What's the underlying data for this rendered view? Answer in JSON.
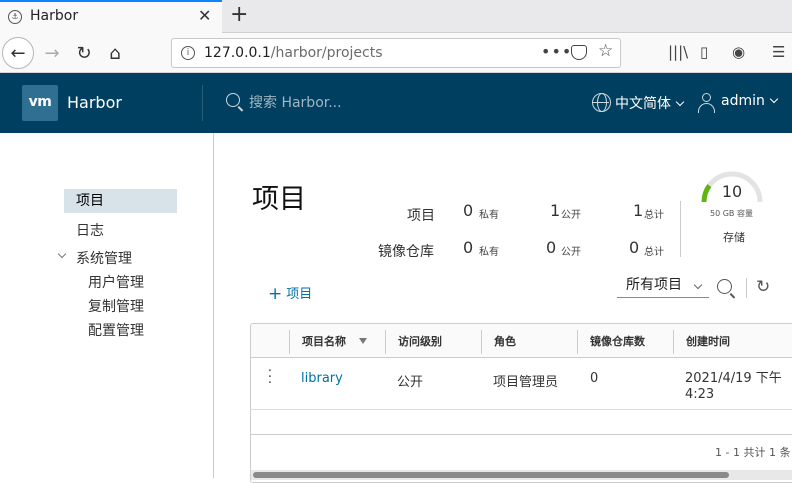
{
  "browser": {
    "tab_title": "Harbor",
    "url_host": "127.0.0.1",
    "url_path": "/harbor/projects"
  },
  "header": {
    "brand_logo": "vm",
    "brand": "Harbor",
    "search_placeholder": "搜索 Harbor...",
    "language": "中文简体",
    "user": "admin"
  },
  "sidebar": {
    "items": [
      {
        "label": "项目",
        "active": true
      },
      {
        "label": "日志"
      },
      {
        "label": "系统管理",
        "expanded": true
      },
      {
        "label": "用户管理"
      },
      {
        "label": "复制管理"
      },
      {
        "label": "配置管理"
      }
    ]
  },
  "main": {
    "title": "项目",
    "summary": {
      "projects_label": "项目",
      "repos_label": "镜像仓库",
      "private_label": "私有",
      "public_label": "公开",
      "total_label": "总计",
      "projects": {
        "private": "0",
        "public": "1",
        "total": "1"
      },
      "repos": {
        "private": "0",
        "public": "0",
        "total": "0"
      }
    },
    "storage": {
      "value": "10",
      "capacity": "50 GB 容量",
      "label": "存储",
      "used_fraction": 0.2
    },
    "add_project": "项目",
    "filter": "所有项目"
  },
  "grid": {
    "columns": [
      "项目名称",
      "访问级别",
      "角色",
      "镜像仓库数",
      "创建时间"
    ],
    "rows": [
      {
        "name": "library",
        "access": "公开",
        "role": "项目管理员",
        "repo_count": "0",
        "created": "2021/4/19 下午\n4:23"
      }
    ],
    "footer": "1 - 1 共计 1 条"
  },
  "colors": {
    "header_bg": "#003f5f",
    "accent_link": "#0072a3",
    "gauge_green": "#60b515"
  }
}
